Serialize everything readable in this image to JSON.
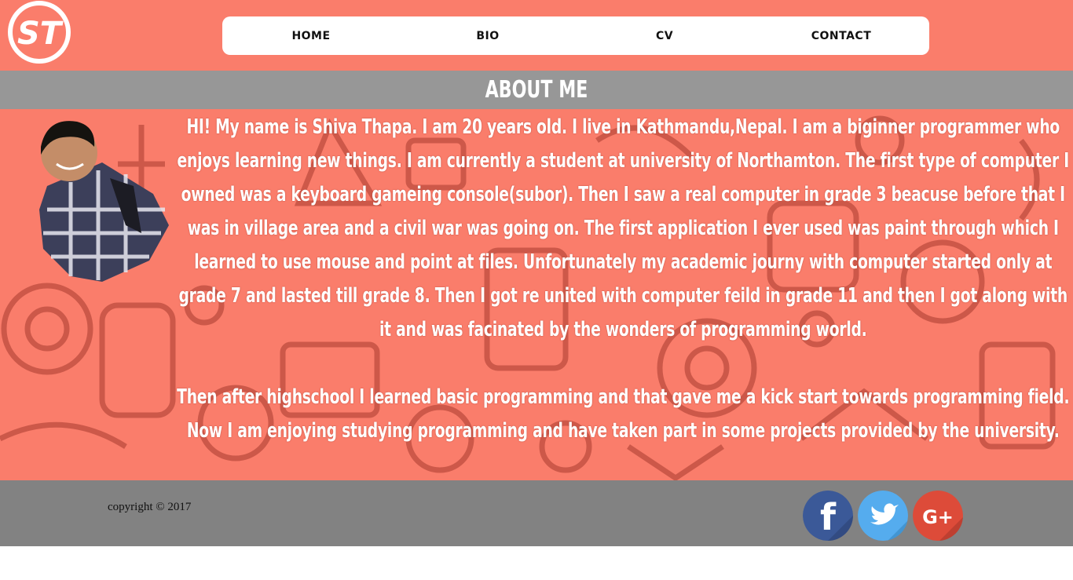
{
  "header": {
    "logo": {
      "icon": "st-monogram-logo-icon",
      "text": "ST"
    },
    "nav": [
      {
        "label": "HOME"
      },
      {
        "label": "BIO"
      },
      {
        "label": "CV"
      },
      {
        "label": "CONTACT"
      }
    ]
  },
  "section": {
    "title": "ABOUT ME",
    "paragraphs": [
      "HI! My name is Shiva Thapa. I am 20 years old. I live in Kathmandu,Nepal. I am a biginner programmer who enjoys learning new things. I am currently a student at university of Northamton. The first type of computer I owned was a keyboard gameing console(subor). Then I saw a real computer in grade 3 beacuse before that I was in village area and a civil war was going on. The first application I ever used was paint through which I learned to use mouse and point at files. Unfortunately my academic journy with computer started only at grade 7 and lasted till grade 8. Then I got re united with computer feild in grade 11 and then I got along with it and was facinated by the wonders of programming world.",
      "Then after highschool I learned basic programming and that gave me a kick start towards programming field. Now I am enjoying studying programming and have taken part in some projects provided by the university."
    ]
  },
  "footer": {
    "copyright": "copyright © 2017",
    "social": [
      {
        "icon": "facebook-icon",
        "label": "f",
        "color": "#3b5998"
      },
      {
        "icon": "twitter-icon",
        "label": "",
        "color": "#55acee"
      },
      {
        "icon": "google-plus-icon",
        "label": "G+",
        "color": "#dd4b39"
      }
    ]
  },
  "colors": {
    "accent": "#fa7d6b",
    "band": "#979797",
    "footer": "#828282"
  }
}
